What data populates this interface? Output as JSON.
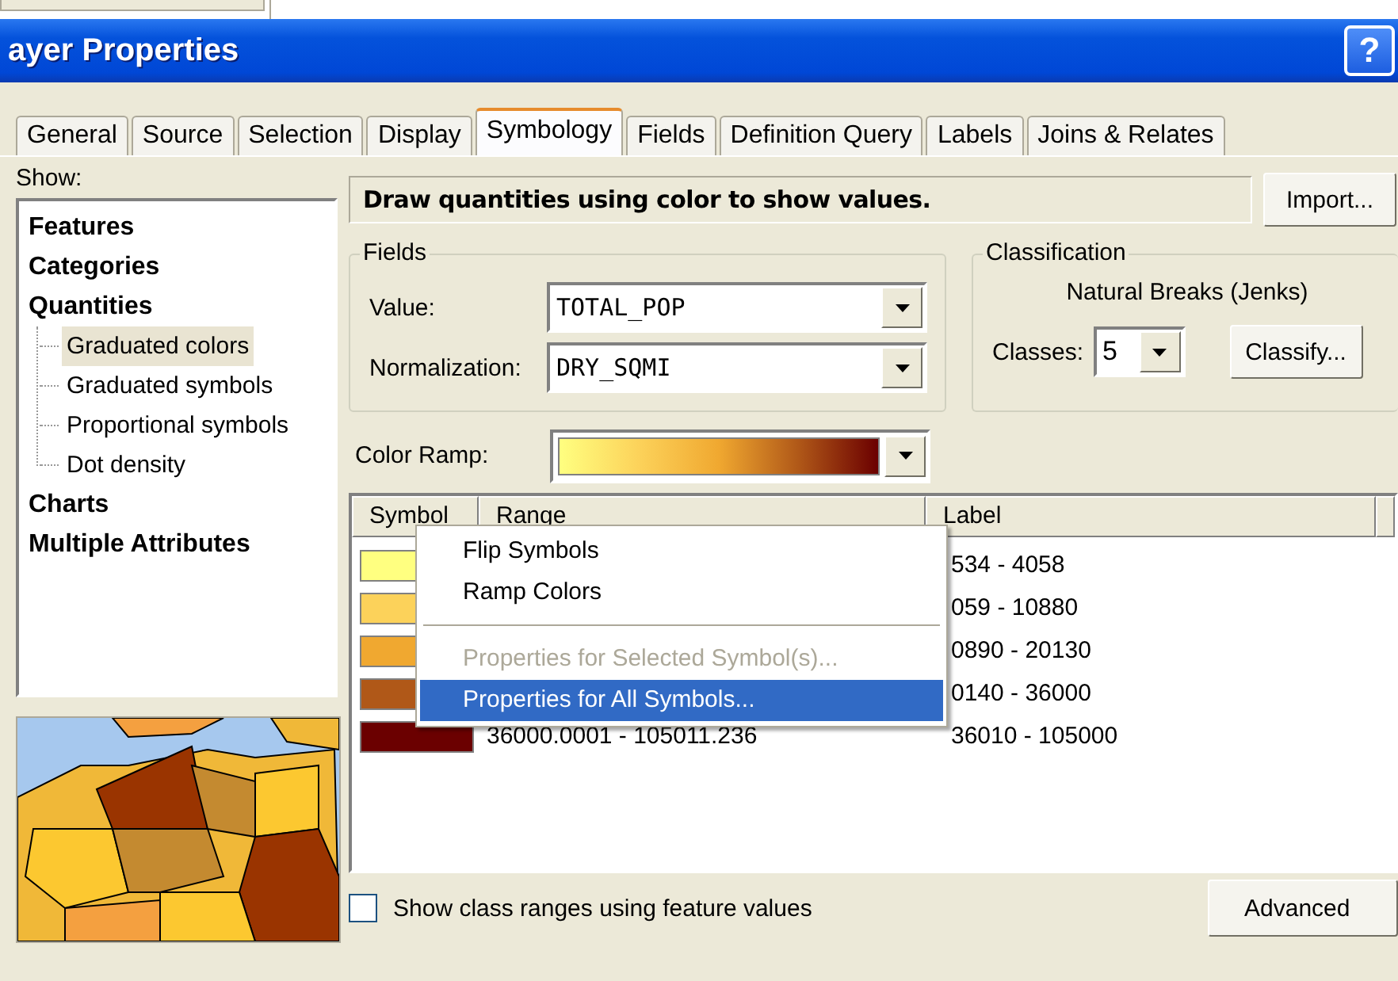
{
  "window": {
    "title": "ayer Properties",
    "help_button": "?"
  },
  "tabs": [
    {
      "label": "General",
      "selected": false
    },
    {
      "label": "Source",
      "selected": false
    },
    {
      "label": "Selection",
      "selected": false
    },
    {
      "label": "Display",
      "selected": false
    },
    {
      "label": "Symbology",
      "selected": true
    },
    {
      "label": "Fields",
      "selected": false
    },
    {
      "label": "Definition Query",
      "selected": false
    },
    {
      "label": "Labels",
      "selected": false
    },
    {
      "label": "Joins & Relates",
      "selected": false
    }
  ],
  "show": {
    "label": "Show:",
    "items": [
      {
        "label": "Features",
        "selected": false
      },
      {
        "label": "Categories",
        "selected": false
      },
      {
        "label": "Quantities",
        "selected": false,
        "children": [
          {
            "label": "Graduated colors",
            "selected": true
          },
          {
            "label": "Graduated symbols",
            "selected": false
          },
          {
            "label": "Proportional symbols",
            "selected": false
          },
          {
            "label": "Dot density",
            "selected": false
          }
        ]
      },
      {
        "label": "Charts",
        "selected": false
      },
      {
        "label": "Multiple Attributes",
        "selected": false
      }
    ]
  },
  "description": "Draw quantities using color to show values.",
  "import_button": "Import...",
  "fields": {
    "title": "Fields",
    "value_label": "Value:",
    "value": "TOTAL_POP",
    "normalization_label": "Normalization:",
    "normalization": "DRY_SQMI"
  },
  "classification": {
    "title": "Classification",
    "method": "Natural Breaks (Jenks)",
    "classes_label": "Classes:",
    "classes": "5",
    "classify_button": "Classify..."
  },
  "color_ramp": {
    "label": "Color Ramp:"
  },
  "table": {
    "columns": [
      "Symbol",
      "Range",
      "Label"
    ],
    "rows": [
      {
        "color": "#ffff80",
        "label": "534 - 4058"
      },
      {
        "color": "#fcd25a",
        "label": "059 - 10880"
      },
      {
        "color": "#f0a830",
        "label": "0890 - 20130"
      },
      {
        "color": "#b05818",
        "label": "0140 - 36000"
      },
      {
        "color": "#6b0000",
        "range": "36000.0001 - 105011.236",
        "label": "36010 - 105000"
      }
    ]
  },
  "context_menu": {
    "items": [
      {
        "kind": "item",
        "label": "Flip Symbols",
        "disabled": false,
        "selected": false
      },
      {
        "kind": "item",
        "label": "Ramp Colors",
        "disabled": false,
        "selected": false
      },
      {
        "kind": "separator"
      },
      {
        "kind": "item",
        "label": "Properties for Selected Symbol(s)...",
        "disabled": true,
        "selected": false
      },
      {
        "kind": "item",
        "label": "Properties for All Symbols...",
        "disabled": false,
        "selected": true
      }
    ]
  },
  "show_class_ranges": {
    "label": "Show class ranges using feature values",
    "checked": false
  },
  "advanced_button": "Advanced"
}
